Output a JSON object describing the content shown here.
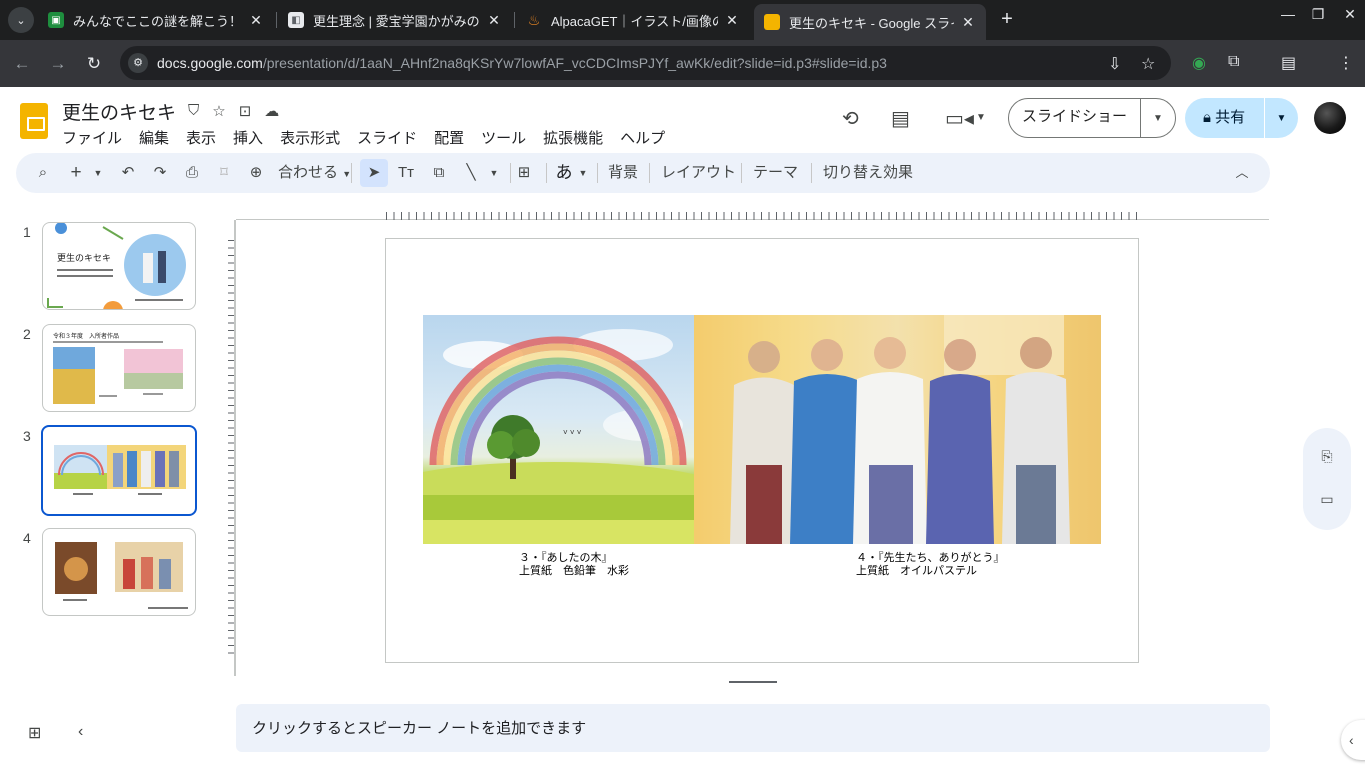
{
  "browser": {
    "tabs": [
      {
        "title": "みんなでここの謎を解こう！",
        "favicon": "flag-icon",
        "active": false
      },
      {
        "title": "更生理念 | 愛宝学園かがみの",
        "favicon": "page-icon",
        "active": false
      },
      {
        "title": "AlpacaGET｜イラスト/画像の",
        "favicon": "fire-icon",
        "active": false
      },
      {
        "title": "更生のキセキ - Google スライド",
        "favicon": "slides-icon",
        "active": true
      }
    ],
    "url_host": "docs.google.com",
    "url_path": "/presentation/d/1aaN_AHnf2na8qKSrYw7lowfAF_vcCDCImsPJYf_awKk/edit?slide=id.p3#slide=id.p3"
  },
  "header": {
    "doc_title": "更生のキセキ",
    "menu": [
      "ファイル",
      "編集",
      "表示",
      "挿入",
      "表示形式",
      "スライド",
      "配置",
      "ツール",
      "拡張機能",
      "ヘルプ"
    ],
    "slideshow_label": "スライドショー",
    "share_label": "共有"
  },
  "toolbar": {
    "zoom_label": "合わせる",
    "text_style_label": "あ",
    "background_label": "背景",
    "layout_label": "レイアウト",
    "theme_label": "テーマ",
    "transition_label": "切り替え効果"
  },
  "filmstrip": {
    "slides": [
      {
        "num": "1",
        "title": "更生のキセキ"
      },
      {
        "num": "2",
        "title": "令和３年度　入所者作品"
      },
      {
        "num": "3",
        "title": ""
      },
      {
        "num": "4",
        "title": ""
      }
    ],
    "active_index": 3
  },
  "slide": {
    "caption_left_line1": "３・『あしたの木』",
    "caption_left_line2": "上質紙　色鉛筆　水彩",
    "caption_right_line1": "４・『先生たち、ありがとう』",
    "caption_right_line2": "上質紙　オイルパステル"
  },
  "notes": {
    "placeholder": "クリックするとスピーカー ノートを追加できます"
  },
  "colors": {
    "accent": "#0b57d0",
    "share_bg": "#c2e7ff",
    "toolbar_bg": "#edf2fa",
    "slides_logo": "#f4b400"
  }
}
